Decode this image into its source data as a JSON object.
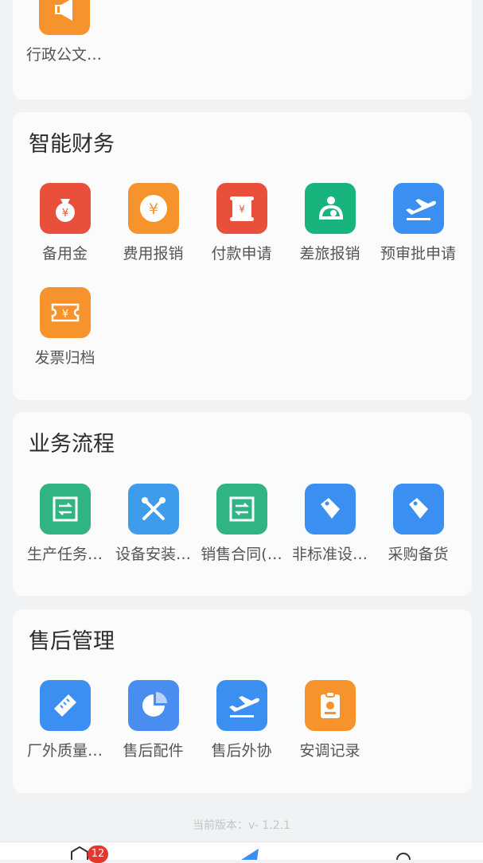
{
  "sections": [
    {
      "title": "",
      "apps": [
        {
          "label": "行政公文…",
          "icon": "megaphone-icon",
          "color": "#f7932c"
        }
      ]
    },
    {
      "title": "智能财务",
      "apps": [
        {
          "label": "备用金",
          "icon": "money-bag-icon",
          "color": "#e9503b"
        },
        {
          "label": "费用报销",
          "icon": "yen-coin-icon",
          "color": "#f7932c"
        },
        {
          "label": "付款申请",
          "icon": "yen-scroll-icon",
          "color": "#e9503b"
        },
        {
          "label": "差旅报销",
          "icon": "person-share-icon",
          "color": "#19b37e"
        },
        {
          "label": "预审批申请",
          "icon": "airplane-icon",
          "color": "#3b8ff0"
        },
        {
          "label": "发票归档",
          "icon": "yen-ticket-icon",
          "color": "#f7932c"
        }
      ]
    },
    {
      "title": "业务流程",
      "apps": [
        {
          "label": "生产任务…",
          "icon": "document-arrows-icon",
          "color": "#31b483"
        },
        {
          "label": "设备安装…",
          "icon": "tools-icon",
          "color": "#3f9bec"
        },
        {
          "label": "销售合同(…",
          "icon": "document-arrows-icon",
          "color": "#31b483"
        },
        {
          "label": "非标准设…",
          "icon": "tag-icon",
          "color": "#3b8ff0"
        },
        {
          "label": "采购备货",
          "icon": "tag-icon",
          "color": "#3b8ff0"
        }
      ]
    },
    {
      "title": "售后管理",
      "apps": [
        {
          "label": "厂外质量…",
          "icon": "ruler-icon",
          "color": "#3b8ff0"
        },
        {
          "label": "售后配件",
          "icon": "pie-chart-icon",
          "color": "#4a8df0"
        },
        {
          "label": "售后外协",
          "icon": "airplane-icon",
          "color": "#3b8ff0"
        },
        {
          "label": "安调记录",
          "icon": "clipboard-icon",
          "color": "#f7932c"
        }
      ]
    }
  ],
  "version_text": "当前版本：v- 1.2.1",
  "tabbar": {
    "badge_count": "12"
  }
}
